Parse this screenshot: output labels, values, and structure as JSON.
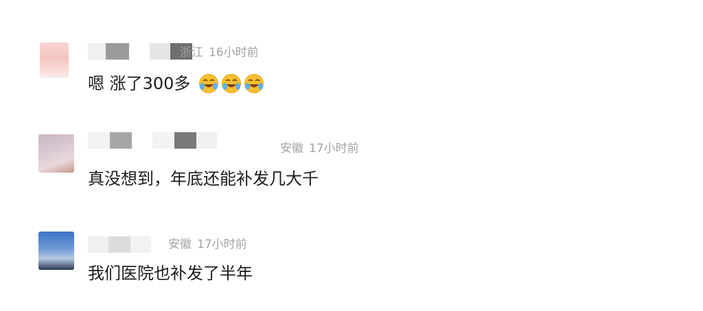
{
  "comments": [
    {
      "location": "浙江",
      "time": "16小时前",
      "text": "嗯 涨了300多",
      "emojis": [
        "laugh-cry-emoji",
        "laugh-cry-emoji",
        "laugh-cry-emoji"
      ]
    },
    {
      "location": "安徽",
      "time": "17小时前",
      "text": "真没想到，年底还能补发几大千"
    },
    {
      "location": "安徽",
      "time": "17小时前",
      "text": "我们医院也补发了半年"
    }
  ],
  "colors": {
    "meta": "#a2a2a2",
    "text": "#1c1c1c",
    "background": "#ffffff"
  }
}
